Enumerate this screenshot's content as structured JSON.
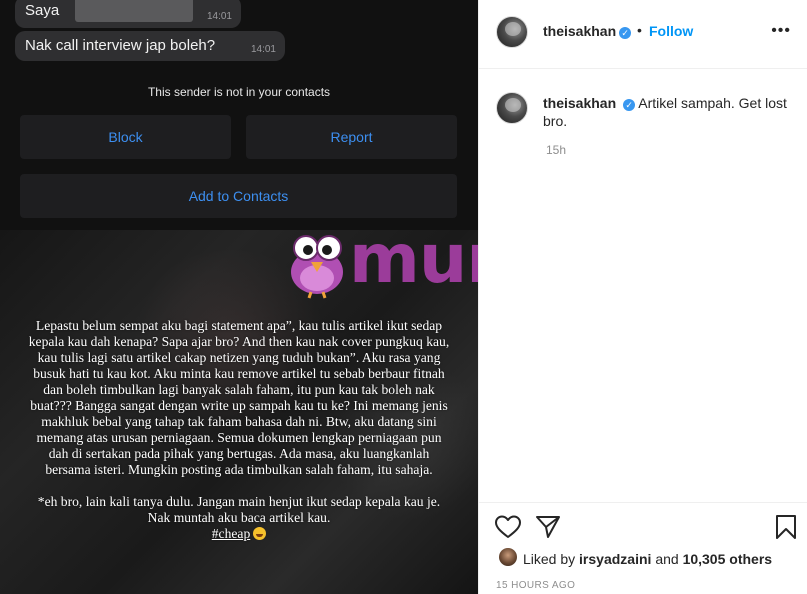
{
  "story": {
    "chat": {
      "bubble1_text": "Saya",
      "bubble1_time": "14:01",
      "bubble2_text": "Nak call interview jap boleh?",
      "bubble2_time": "14:01"
    },
    "sender_note": "This sender is not in your contacts",
    "block_label": "Block",
    "report_label": "Report",
    "add_contacts_label": "Add to Contacts",
    "paragraph": "Lepastu belum sempat aku bagi statement apa”, kau tulis artikel ikut sedap kepala kau dah kenapa? Sapa ajar bro? And then kau nak cover pungkuq kau, kau tulis lagi satu artikel cakap netizen yang tuduh bukan”. Aku rasa yang busuk hati tu kau kot. Aku minta kau remove artikel tu sebab berbaur fitnah dan boleh timbulkan lagi banyak salah faham, itu pun kau tak boleh nak buat??? Bangga sangat dengan write up sampah kau tu ke? Ini memang jenis makhluk bebal yang tahap tak faham bahasa dah ni. Btw, aku datang sini memang atas urusan perniagaan. Semua dokumen lengkap perniagaan pun dah di sertakan pada pihak yang bertugas. Ada masa, aku luangkanlah bersama isteri. Mungkin posting ada timbulkan salah faham, itu sahaja.",
    "ps": "*eh bro, lain kali tanya dulu. Jangan main henjut ikut sedap kepala kau je. Nak muntah aku baca artikel kau.",
    "hashtag": "#cheap",
    "watermark_text": "murai"
  },
  "panel": {
    "username": "theisakhan",
    "separator": "•",
    "follow_label": "Follow",
    "more_icon": "•••",
    "caption_text": "Artikel sampah. Get lost bro.",
    "caption_time": "15h",
    "liked_by_prefix": "Liked by",
    "liked_by_user": "irsyadzaini",
    "liked_and": "and",
    "liked_others": "10,305 others",
    "post_age": "15 HOURS AGO"
  },
  "colors": {
    "accent_blue": "#0095f6",
    "verified_blue": "#3897f0",
    "ios_link_blue": "#3d8ff0",
    "watermark_purple": "#9b3c9a"
  },
  "icons": [
    "heart-icon",
    "share-icon",
    "bookmark-icon",
    "more-icon",
    "verified-icon",
    "bird-mascot-icon"
  ]
}
